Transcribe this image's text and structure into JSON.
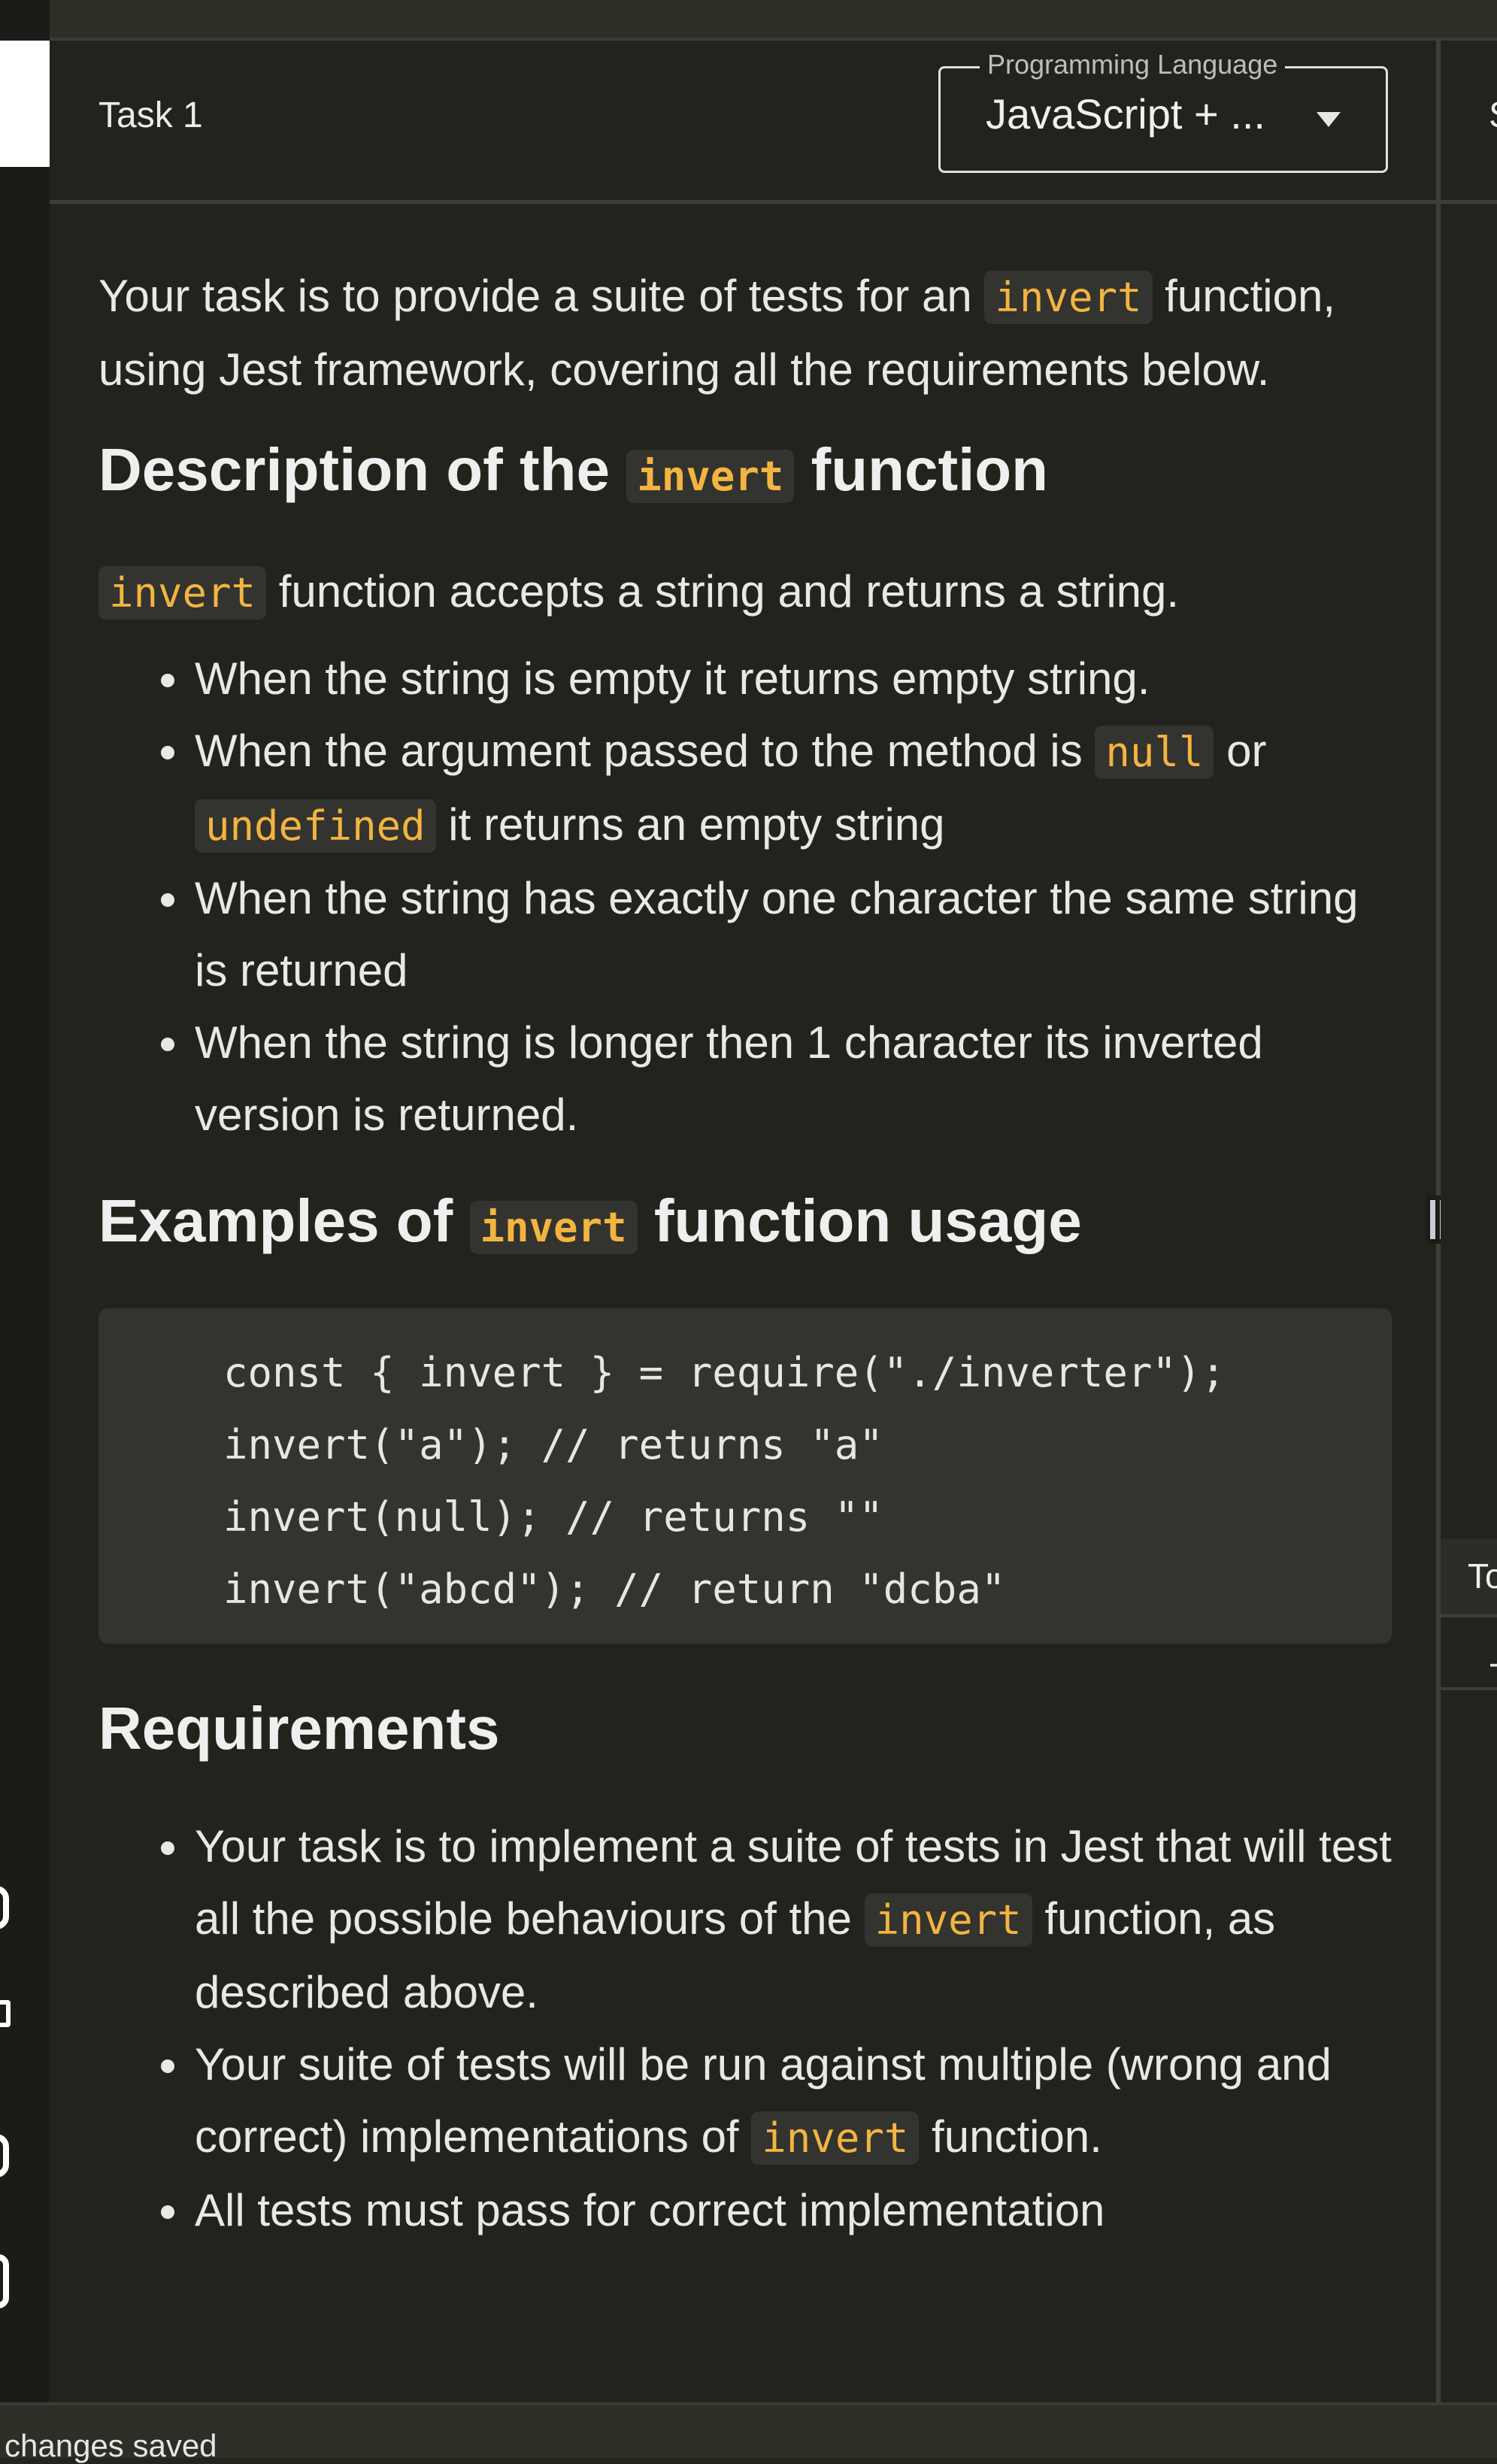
{
  "task": {
    "title": "Task 1"
  },
  "language_select": {
    "label": "Programming Language",
    "value": "JavaScript + ..."
  },
  "right_panel": {
    "title_partial": "S",
    "tab_partial": "To",
    "row_partial": "-"
  },
  "content": {
    "intro": {
      "before": "Your task is to provide a suite of tests for an ",
      "code": "invert",
      "after": " function, using Jest framework, covering all the requirements below."
    },
    "description_heading": {
      "before": "Description of the ",
      "code": "invert",
      "after": " function"
    },
    "accepts": {
      "code": "invert",
      "after": " function accepts a string and returns a string."
    },
    "behaviours": [
      {
        "text": "When the string is empty it returns empty string."
      },
      {
        "before": "When the argument passed to the method is ",
        "code1": "null",
        "middle": " or ",
        "code2": "undefined",
        "after": " it returns an empty string"
      },
      {
        "text": "When the string has exactly one character the same string is returned"
      },
      {
        "text": "When the string is longer then 1 character its inverted version is returned."
      }
    ],
    "examples_heading": {
      "before": "Examples of ",
      "code": "invert",
      "after": " function usage"
    },
    "code_lines": [
      "const { invert } = require(\"./inverter\");",
      "invert(\"a\"); // returns \"a\"",
      "invert(null); // returns \"\"",
      "invert(\"abcd\"); // return \"dcba\""
    ],
    "requirements_heading": "Requirements",
    "requirements": [
      {
        "before": "Your task is to implement a suite of tests in Jest that will test all the possible behaviours of the ",
        "code": "invert",
        "after": " function, as described above."
      },
      {
        "before": "Your suite of tests will be run against multiple (wrong and correct) implementations of ",
        "code": "invert",
        "after": " function."
      },
      {
        "text": "All tests must pass for correct implementation"
      }
    ]
  },
  "status": {
    "text": "changes saved"
  },
  "colors": {
    "accent_code": "#f3b440",
    "background": "#23231e",
    "code_bg": "#33332f"
  }
}
